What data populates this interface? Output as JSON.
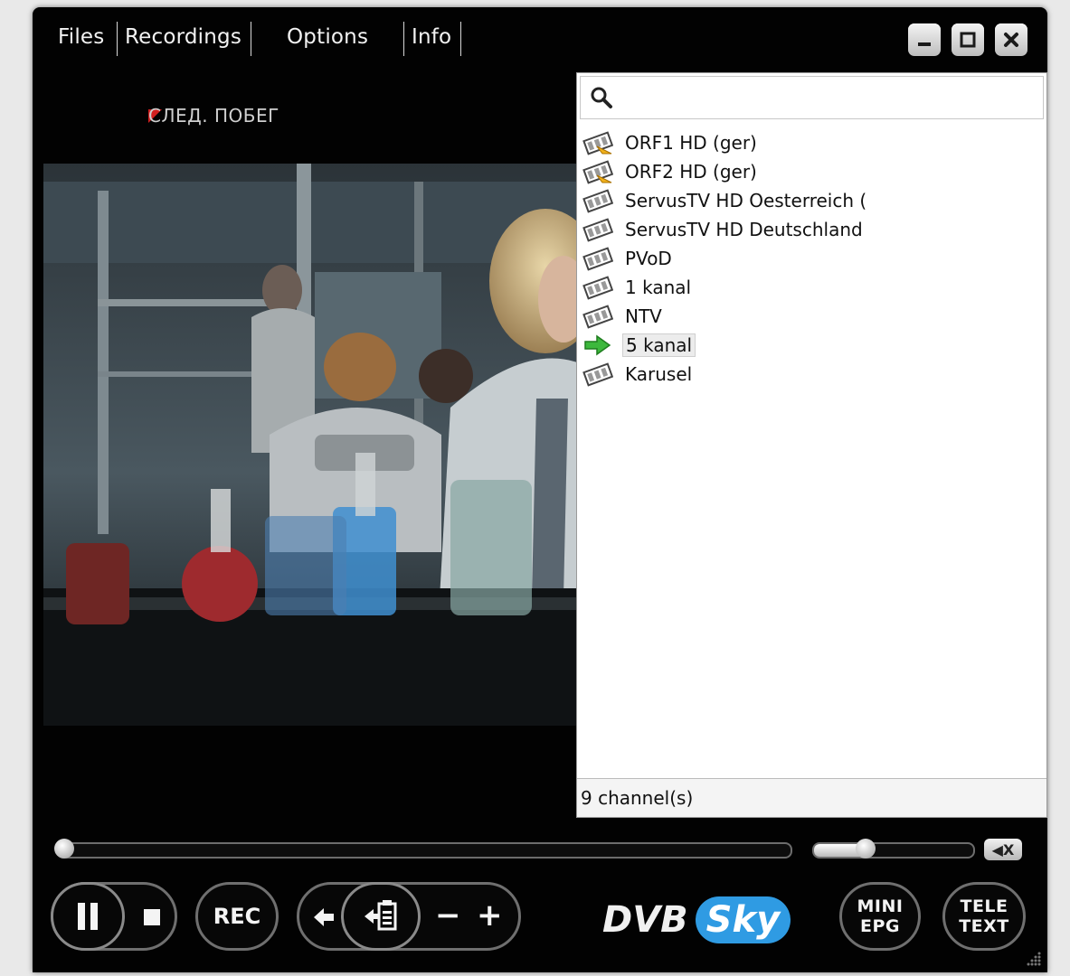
{
  "menu": {
    "items": [
      {
        "id": "files",
        "label": "Files"
      },
      {
        "id": "recordings",
        "label": "Recordings"
      },
      {
        "id": "options",
        "label": "Options"
      },
      {
        "id": "info",
        "label": "Info"
      }
    ]
  },
  "window_controls": {
    "minimize_icon": "minimize-icon",
    "maximize_icon": "maximize-icon",
    "close_icon": "close-icon"
  },
  "tv_logo": {
    "text": "СЛЕД. ПОБЕГ"
  },
  "channel_panel": {
    "search": {
      "value": "",
      "placeholder": ""
    },
    "channels": [
      {
        "name": "ORF1 HD (ger)",
        "icon": "encrypted-film-icon",
        "selected": false
      },
      {
        "name": "ORF2 HD (ger)",
        "icon": "encrypted-film-icon",
        "selected": false
      },
      {
        "name": "ServusTV HD Oesterreich (",
        "icon": "film-icon",
        "selected": false
      },
      {
        "name": "ServusTV HD Deutschland",
        "icon": "film-icon",
        "selected": false
      },
      {
        "name": "PVoD",
        "icon": "film-icon",
        "selected": false
      },
      {
        "name": "1 kanal",
        "icon": "film-icon",
        "selected": false
      },
      {
        "name": "NTV",
        "icon": "film-icon",
        "selected": false
      },
      {
        "name": "5 kanal",
        "icon": "play-arrow-icon",
        "selected": true
      },
      {
        "name": "Karusel",
        "icon": "film-icon",
        "selected": false
      }
    ],
    "status": "9 channel(s)"
  },
  "playback": {
    "seek_position": 0.0,
    "volume_level": 0.35,
    "mute_label": "◀X"
  },
  "controls": {
    "pause_icon": "pause-icon",
    "stop_icon": "stop-icon",
    "rec_label": "REC",
    "prev_icon": "arrow-left-icon",
    "channel_list_icon": "channel-list-icon",
    "minus_label": "−",
    "plus_label": "+",
    "mini_epg_line1": "MINI",
    "mini_epg_line2": "EPG",
    "teletext_line1": "TELE",
    "teletext_line2": "TEXT"
  },
  "brand": {
    "part1": "DVB",
    "part2": "Sky",
    "accent": "#2f9be3"
  }
}
